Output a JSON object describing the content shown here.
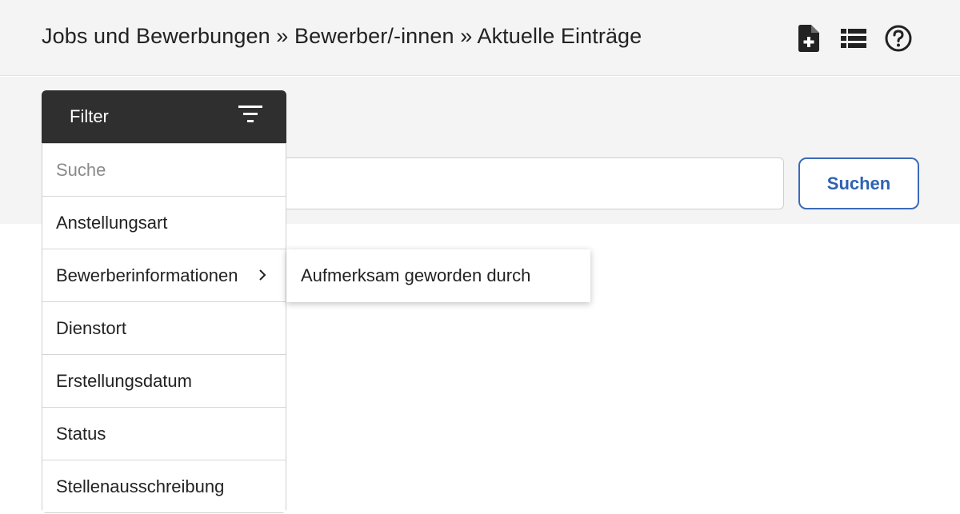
{
  "header": {
    "breadcrumb": "Jobs und Bewerbungen » Bewerber/-innen » Aktuelle Einträge",
    "icons": [
      "new-document-icon",
      "list-icon",
      "help-icon"
    ]
  },
  "filter": {
    "label": "Filter",
    "icon": "filter-icon"
  },
  "search": {
    "value": "",
    "button_label": "Suchen"
  },
  "dropdown": {
    "search_placeholder": "Suche",
    "items": [
      {
        "label": "Anstellungsart"
      },
      {
        "label": "Bewerberinformationen",
        "has_submenu": true
      },
      {
        "label": "Dienstort"
      },
      {
        "label": "Erstellungsdatum"
      },
      {
        "label": "Status"
      },
      {
        "label": "Stellenausschreibung"
      }
    ]
  },
  "submenu": {
    "items": [
      {
        "label": "Aufmerksam geworden durch"
      }
    ]
  },
  "colors": {
    "header_bg": "#f4f4f4",
    "filter_bg": "#2f2f2f",
    "accent_blue": "#2e62b2"
  }
}
